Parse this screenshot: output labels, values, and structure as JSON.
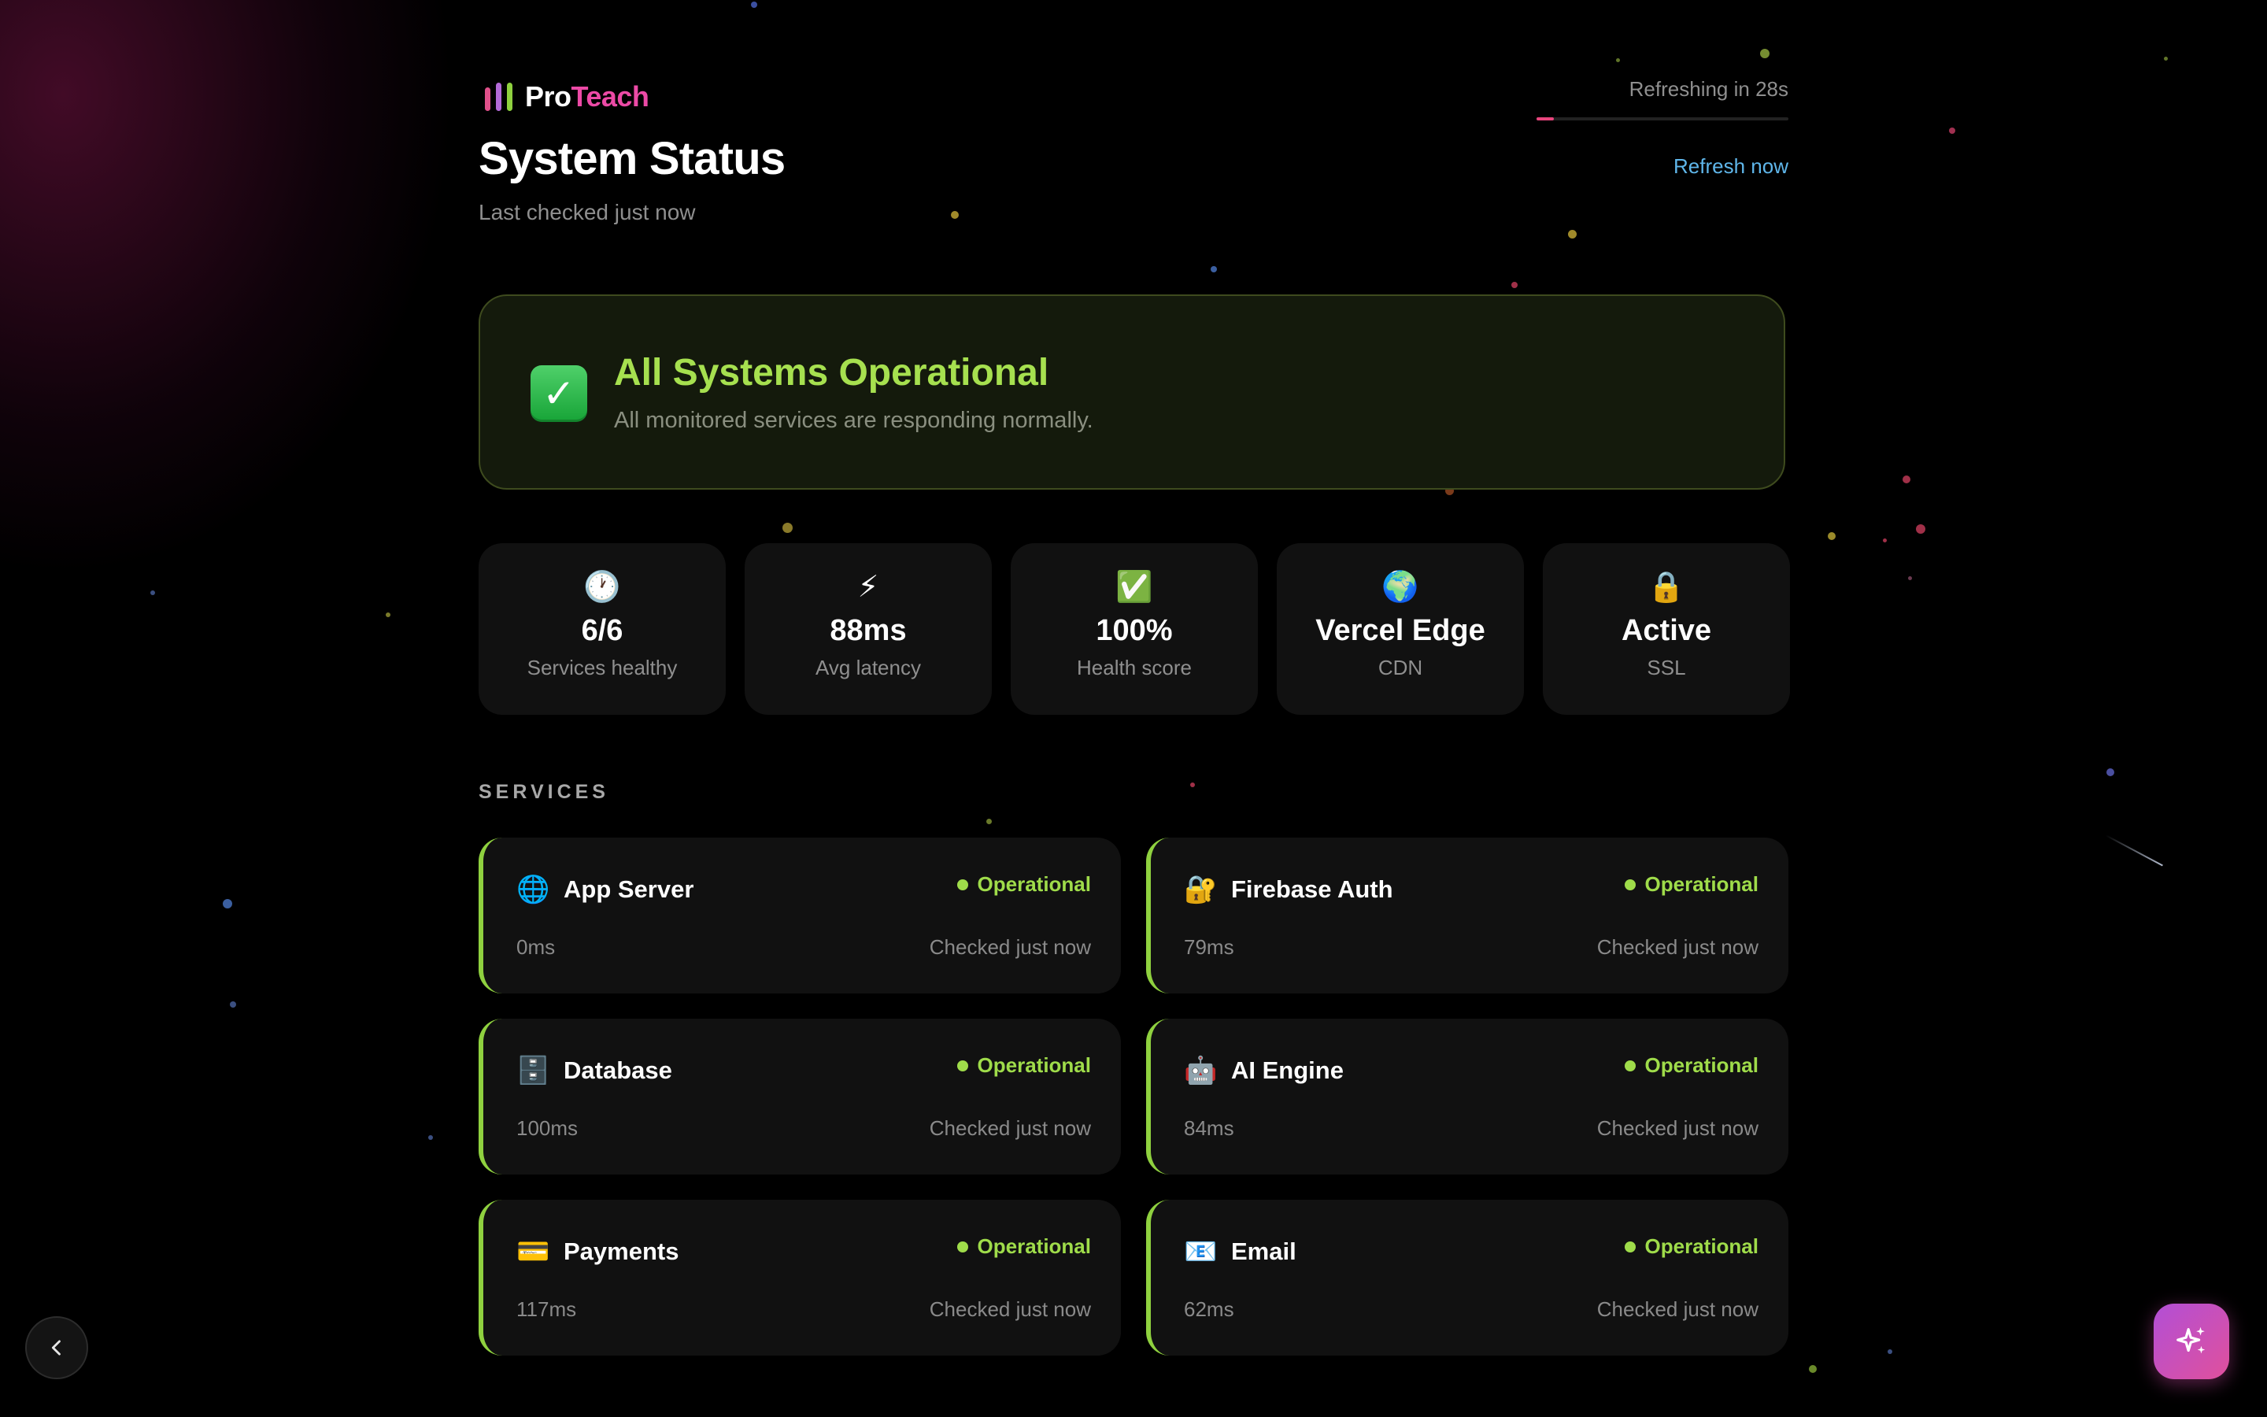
{
  "brand": {
    "pro": "Pro",
    "teach": "Teach",
    "bar_colors": [
      "#e0508a",
      "#b36ad8",
      "#8fd13f"
    ]
  },
  "header": {
    "title": "System Status",
    "subtitle": "Last checked just now",
    "refresh_text": "Refreshing in 28s",
    "refresh_progress": 0.07,
    "refresh_link": "Refresh now"
  },
  "banner": {
    "icon": "check-box-icon",
    "title": "All Systems Operational",
    "description": "All monitored services are responding normally."
  },
  "stats": [
    {
      "icon": "🕐",
      "value": "6/6",
      "label": "Services healthy"
    },
    {
      "icon": "⚡",
      "value": "88ms",
      "label": "Avg latency"
    },
    {
      "icon": "✅",
      "value": "100%",
      "label": "Health score"
    },
    {
      "icon": "🌍",
      "value": "Vercel Edge",
      "label": "CDN"
    },
    {
      "icon": "🔒",
      "value": "Active",
      "label": "SSL"
    }
  ],
  "services_heading": "SERVICES",
  "services": [
    {
      "icon": "🌐",
      "name": "App Server",
      "status": "Operational",
      "latency": "0ms",
      "checked": "Checked just now"
    },
    {
      "icon": "🔐",
      "name": "Firebase Auth",
      "status": "Operational",
      "latency": "79ms",
      "checked": "Checked just now"
    },
    {
      "icon": "🗄️",
      "name": "Database",
      "status": "Operational",
      "latency": "100ms",
      "checked": "Checked just now"
    },
    {
      "icon": "🤖",
      "name": "AI Engine",
      "status": "Operational",
      "latency": "84ms",
      "checked": "Checked just now"
    },
    {
      "icon": "💳",
      "name": "Payments",
      "status": "Operational",
      "latency": "117ms",
      "checked": "Checked just now"
    },
    {
      "icon": "📧",
      "name": "Email",
      "status": "Operational",
      "latency": "62ms",
      "checked": "Checked just now"
    }
  ],
  "colors": {
    "accent_green": "#9fdc4a",
    "accent_pink": "#ec4aa6",
    "link_blue": "#5fb6ea",
    "background": "#000000",
    "card": "#111111"
  },
  "floating": {
    "back_icon": "chevron-left-icon",
    "assistant_icon": "sparkles-icon"
  }
}
